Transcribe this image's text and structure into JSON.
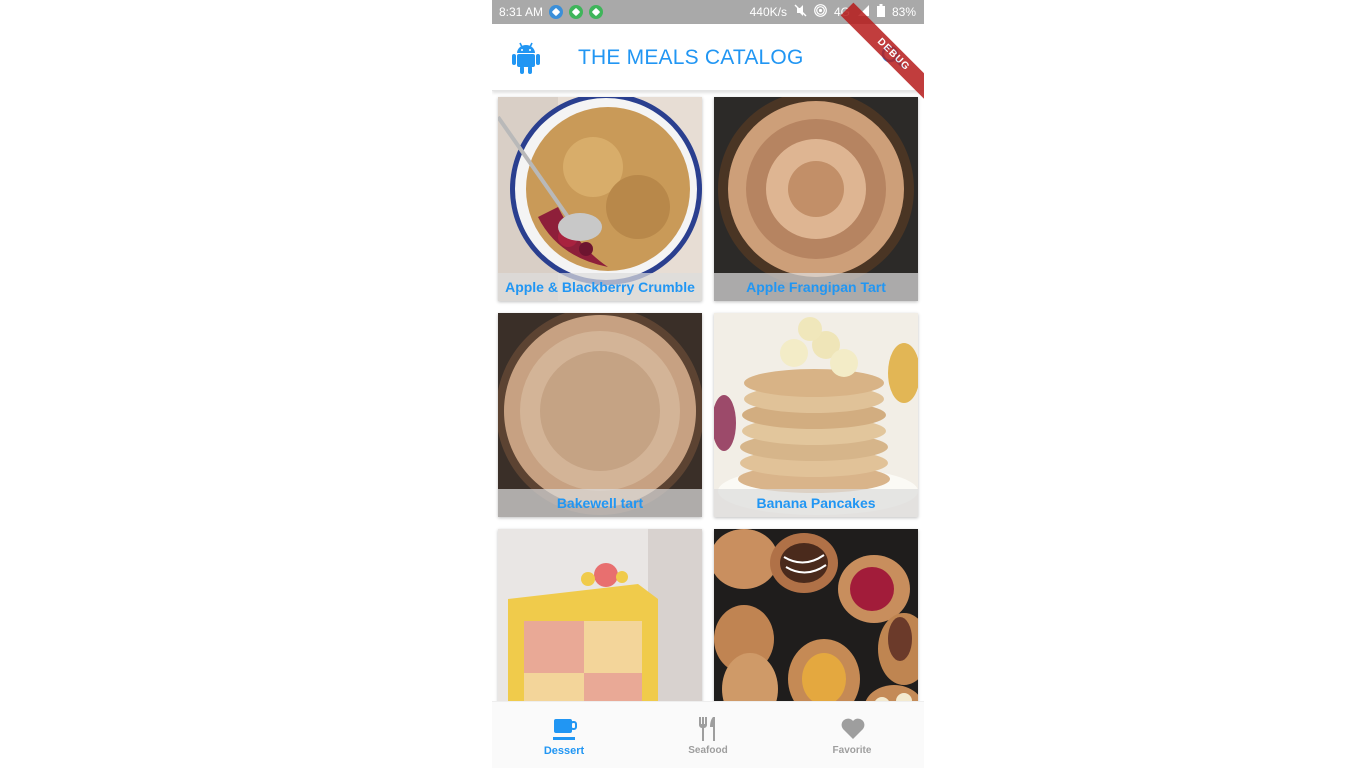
{
  "status_bar": {
    "time": "8:31 AM",
    "net_speed": "440K/s",
    "network": "4G",
    "battery": "83%"
  },
  "app_bar": {
    "title": "THE MEALS CATALOG",
    "leading_icon": "android-icon",
    "action_icon": "search-icon",
    "debug_banner": "DEBUG"
  },
  "meals": [
    {
      "name": "Apple & Blackberry Crumble"
    },
    {
      "name": "Apple Frangipan Tart"
    },
    {
      "name": "Bakewell tart"
    },
    {
      "name": "Banana Pancakes"
    },
    {
      "name": ""
    },
    {
      "name": ""
    }
  ],
  "bottom_nav": {
    "items": [
      {
        "label": "Dessert",
        "icon": "cup-icon",
        "active": true
      },
      {
        "label": "Seafood",
        "icon": "fork-knife-icon",
        "active": false
      },
      {
        "label": "Favorite",
        "icon": "heart-icon",
        "active": false
      }
    ]
  },
  "colors": {
    "accent": "#2196f3",
    "inactive": "#9e9e9e",
    "status_bar": "#a9a9a9"
  }
}
